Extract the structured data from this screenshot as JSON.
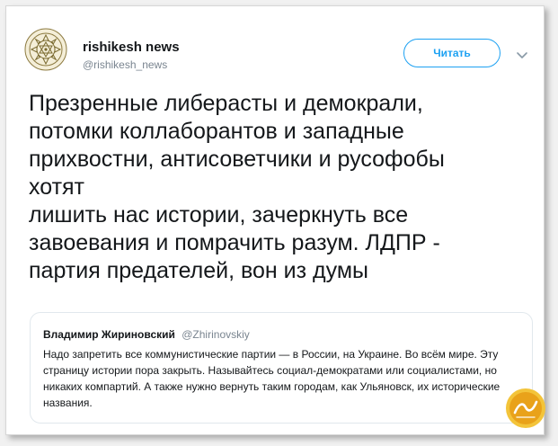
{
  "tweet": {
    "author_name": "rishikesh news",
    "author_handle": "@rishikesh_news",
    "follow_label": "Читать",
    "text": "Презренные либерасты и демокрали,\nпотомки коллаборантов и западные\nприхвостни, антисоветчики и русофобы\nхотят\nлишить нас истории, зачеркнуть все\nзавоевания и помрачить разум. ЛДПР -\nпартия предателей, вон из думы"
  },
  "quoted_tweet": {
    "author_name": "Владимир Жириновский",
    "author_handle": "@Zhirinovskiy",
    "text": "Надо запретить все коммунистические партии — в России, на Украине. Во всём мире. Эту страницу истории пора закрыть. Называйтесь социал-демократами или социалистами, но никаких компартий. А также нужно вернуть таким городам, как Ульяновск, их исторические названия."
  },
  "icons": {
    "avatar": "yantra-emblem-icon",
    "menu": "chevron-down-icon",
    "watermark": "site-logo-icon"
  },
  "colors": {
    "accent": "#1da1f2",
    "text": "#14171a",
    "secondary_text": "#7a8590",
    "card_border": "#e1e8ed",
    "page_background": "#f1f1f1"
  }
}
